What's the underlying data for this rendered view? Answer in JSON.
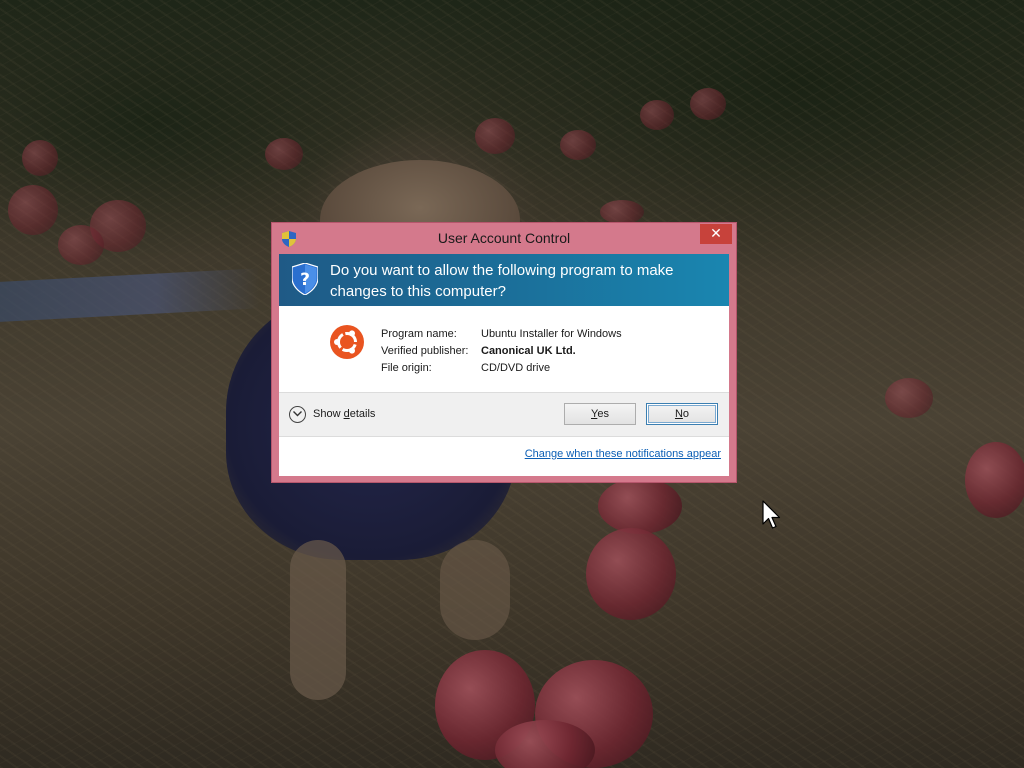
{
  "window": {
    "title": "User Account Control",
    "close_glyph": "✕",
    "accent_color": "#d4798c",
    "header_color": "#1b6e99"
  },
  "header": {
    "question": "Do you want to allow the following program to make changes to this computer?",
    "icon": "shield-question-icon"
  },
  "details": {
    "icon": "ubuntu-logo-icon",
    "rows": [
      {
        "label": "Program name:",
        "value": "Ubuntu Installer for Windows"
      },
      {
        "label": "Verified publisher:",
        "value": "Canonical UK Ltd."
      },
      {
        "label": "File origin:",
        "value": "CD/DVD drive"
      }
    ]
  },
  "buttons": {
    "show_details_prefix": "Show ",
    "show_details_accel": "d",
    "show_details_suffix": "etails",
    "yes_accel": "Y",
    "yes_rest": "es",
    "no_accel": "N",
    "no_rest": "o"
  },
  "footer": {
    "link": "Change when these notifications appear"
  },
  "desktop": {
    "background": "photo of a dog in a blue sweater among fallen apples, dimmed"
  }
}
